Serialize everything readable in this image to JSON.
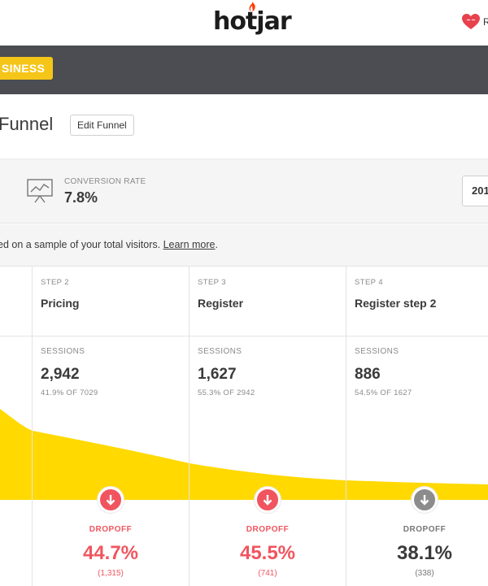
{
  "brand": {
    "logo": "hotjar",
    "user_initial": "R"
  },
  "plan": {
    "badge": "SINESS"
  },
  "page": {
    "title": "Funnel",
    "edit_button": "Edit Funnel"
  },
  "stats": {
    "conversion_label": "CONVERSION RATE",
    "conversion_value": "7.8%",
    "date_button": "201"
  },
  "notice": {
    "text": "ed on a sample of your total visitors. ",
    "link": "Learn more",
    "suffix": "."
  },
  "colors": {
    "funnel_fill": "#ffd900",
    "dropoff_red": "#f0555f",
    "dropoff_gray": "#8c8c8c",
    "plan_badge": "#f5c518",
    "plan_band": "#4b4d52"
  },
  "steps": [
    {
      "step_label": "STEP 2",
      "name": "Pricing",
      "sessions_label": "SESSIONS",
      "sessions": "2,942",
      "sessions_sub": "41.9% OF 7029",
      "dropoff_label": "DROPOFF",
      "dropoff_pct": "44.7%",
      "dropoff_count": "(1,315)",
      "dropoff_color": "red",
      "dropoff_icon": "arrow-down-icon"
    },
    {
      "step_label": "STEP 3",
      "name": "Register",
      "sessions_label": "SESSIONS",
      "sessions": "1,627",
      "sessions_sub": "55.3% OF 2942",
      "dropoff_label": "DROPOFF",
      "dropoff_pct": "45.5%",
      "dropoff_count": "(741)",
      "dropoff_color": "red",
      "dropoff_icon": "arrow-down-icon"
    },
    {
      "step_label": "STEP 4",
      "name": "Register step 2",
      "sessions_label": "SESSIONS",
      "sessions": "886",
      "sessions_sub": "54.5% OF 1627",
      "dropoff_label": "DROPOFF",
      "dropoff_pct": "38.1%",
      "dropoff_count": "(338)",
      "dropoff_color": "gray",
      "dropoff_icon": "arrow-down-icon"
    }
  ]
}
